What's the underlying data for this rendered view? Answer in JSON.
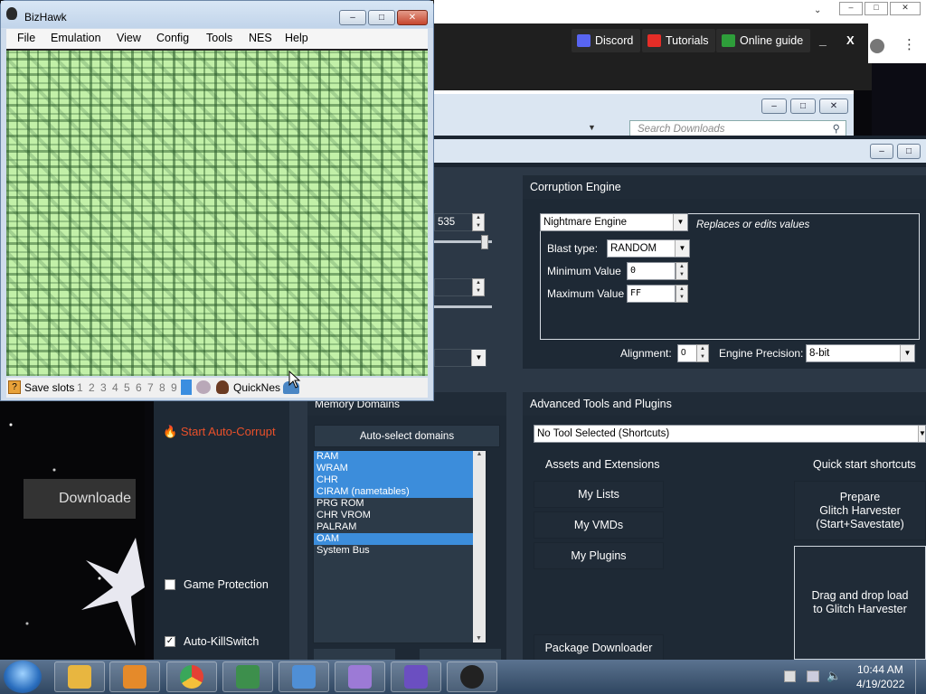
{
  "desktop": {
    "download_label": "Downloade"
  },
  "browser": {
    "buttons": [
      {
        "label": "Discord",
        "icon": "discord-icon",
        "color": "#5865f2"
      },
      {
        "label": "Tutorials",
        "icon": "youtube-icon",
        "color": "#e52d27"
      },
      {
        "label": "Online guide",
        "icon": "guide-icon",
        "color": "#2e9e3a"
      }
    ],
    "minimize_label": "_",
    "close_label": "X",
    "search_placeholder": "Search Downloads"
  },
  "rtc": {
    "value_fragment": "535",
    "corruption_engine": {
      "header": "Corruption Engine",
      "engine": "Nightmare Engine",
      "engine_desc": "Replaces or edits values",
      "blast_type_label": "Blast type:",
      "blast_type": "RANDOM",
      "min_label": "Minimum Value",
      "min_value": "0",
      "max_label": "Maximum Value",
      "max_value": "FF",
      "alignment_label": "Alignment:",
      "alignment_value": "0",
      "precision_label": "Engine Precision:",
      "precision_value": "8-bit"
    },
    "memory_domains": {
      "header": "Memory Domains",
      "autoselect_label": "Auto-select domains",
      "items": [
        {
          "label": "RAM",
          "selected": true
        },
        {
          "label": "WRAM",
          "selected": true
        },
        {
          "label": "CHR",
          "selected": true
        },
        {
          "label": "CIRAM (nametables)",
          "selected": true
        },
        {
          "label": "PRG ROM",
          "selected": false
        },
        {
          "label": "CHR VROM",
          "selected": false
        },
        {
          "label": "PALRAM",
          "selected": false
        },
        {
          "label": "OAM",
          "selected": true
        },
        {
          "label": "System Bus",
          "selected": false
        }
      ]
    },
    "left": {
      "start_autocorrupt": "Start Auto-Corrupt",
      "game_protection": "Game Protection",
      "auto_killswitch": "Auto-KillSwitch"
    },
    "advanced": {
      "header": "Advanced Tools and Plugins",
      "tool_select": "No Tool Selected (Shortcuts)",
      "assets_header": "Assets and Extensions",
      "my_lists": "My Lists",
      "my_vmds": "My VMDs",
      "my_plugins": "My Plugins",
      "package_downloader": "Package Downloader",
      "quick_start_header": "Quick start shortcuts",
      "prepare_line1": "Prepare",
      "prepare_line2": "Glitch Harvester",
      "prepare_line3": "(Start+Savestate)",
      "drag_line1": "Drag and drop load",
      "drag_line2": "to Glitch Harvester"
    }
  },
  "bizhawk": {
    "title": "BizHawk",
    "menu": [
      "File",
      "Emulation",
      "View",
      "Config",
      "Tools",
      "NES",
      "Help"
    ],
    "save_slots_label": "Save slots",
    "slots": [
      "1",
      "2",
      "3",
      "4",
      "5",
      "6",
      "7",
      "8",
      "9",
      "0"
    ],
    "core_label": "QuickNes"
  },
  "taskbar": {
    "time": "10:44 AM",
    "date": "4/19/2022",
    "apps": [
      {
        "icon": "file-explorer-icon",
        "color": "#e8b640"
      },
      {
        "icon": "media-player-icon",
        "color": "#e58a2a"
      },
      {
        "icon": "chrome-icon",
        "color": "#e44134"
      },
      {
        "icon": "monitor-app-icon",
        "color": "#3d8f4c"
      },
      {
        "icon": "control-panel-icon",
        "color": "#4f8fd6"
      },
      {
        "icon": "rtc-logo-icon",
        "color": "#9c7ad6"
      },
      {
        "icon": "glitch-cat-icon",
        "color": "#6b4fc1"
      },
      {
        "icon": "anonymous-mask-icon",
        "color": "#222222"
      }
    ]
  }
}
